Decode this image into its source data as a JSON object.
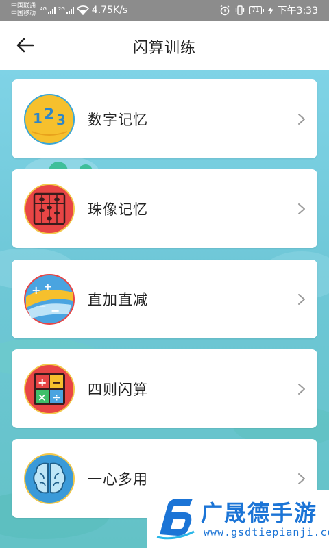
{
  "status_bar": {
    "carrier_1": "中国联通",
    "carrier_2": "中国移动",
    "sim1_type": "4G",
    "sim2_type": "2G",
    "speed": "4.75K/s",
    "battery": "71",
    "time": "下午3:33"
  },
  "header": {
    "title": "闪算训练",
    "back_icon": "arrow-left-icon"
  },
  "menu": {
    "items": [
      {
        "label": "数字记忆",
        "icon": "numbers-123-icon",
        "icon_color": "#f6c02d"
      },
      {
        "label": "珠像记忆",
        "icon": "abacus-icon",
        "icon_color": "#e84545"
      },
      {
        "label": "直加直减",
        "icon": "plus-minus-icon",
        "icon_color": "#4aa4e0"
      },
      {
        "label": "四则闪算",
        "icon": "calculator-icon",
        "icon_color": "#e84545"
      },
      {
        "label": "一心多用",
        "icon": "brain-icon",
        "icon_color": "#3a9ad9"
      }
    ]
  },
  "watermark": {
    "brand": "广晟德手游",
    "url": "www.gsdtiepianji.com"
  },
  "colors": {
    "background_top": "#7fd3e6",
    "background_bottom": "#63c2c6",
    "brand_blue": "#1b74d6"
  }
}
